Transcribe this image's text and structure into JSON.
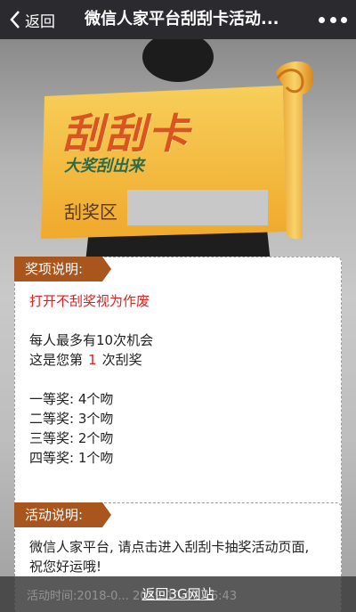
{
  "topbar": {
    "back_label": "返回",
    "title": "微信人家平台刮刮卡活动...",
    "back_icon": "chevron-left-icon",
    "more_icon": "more-dots-icon"
  },
  "card": {
    "title": "刮刮卡",
    "subtitle": "大奖刮出来",
    "scratch_label": "刮奖区"
  },
  "prize_panel": {
    "tag": "奖项说明:",
    "void_notice": "打开不刮奖视为作废",
    "max_chances": "每人最多有10次机会",
    "count_prefix": "这是您第",
    "count_value": "1",
    "count_suffix": "次刮奖",
    "prizes": [
      "一等奖: 4个吻",
      "二等奖: 3个吻",
      "三等奖: 2个吻",
      "四等奖: 1个吻"
    ]
  },
  "activity_panel": {
    "tag": "活动说明:",
    "desc_line1": "微信人家平台, 请点击进入刮刮卡抽奖活动页面,",
    "desc_line2": "祝您好运哦!"
  },
  "footer": {
    "link": "返回3G网站",
    "ghost_text": "活动时间:2018-0... 2019-10-01 16:43"
  },
  "colors": {
    "accent": "#a8551e",
    "card_gold": "#f4b43a",
    "highlight_red": "#e02020",
    "topbar": "#2b2b2f"
  }
}
